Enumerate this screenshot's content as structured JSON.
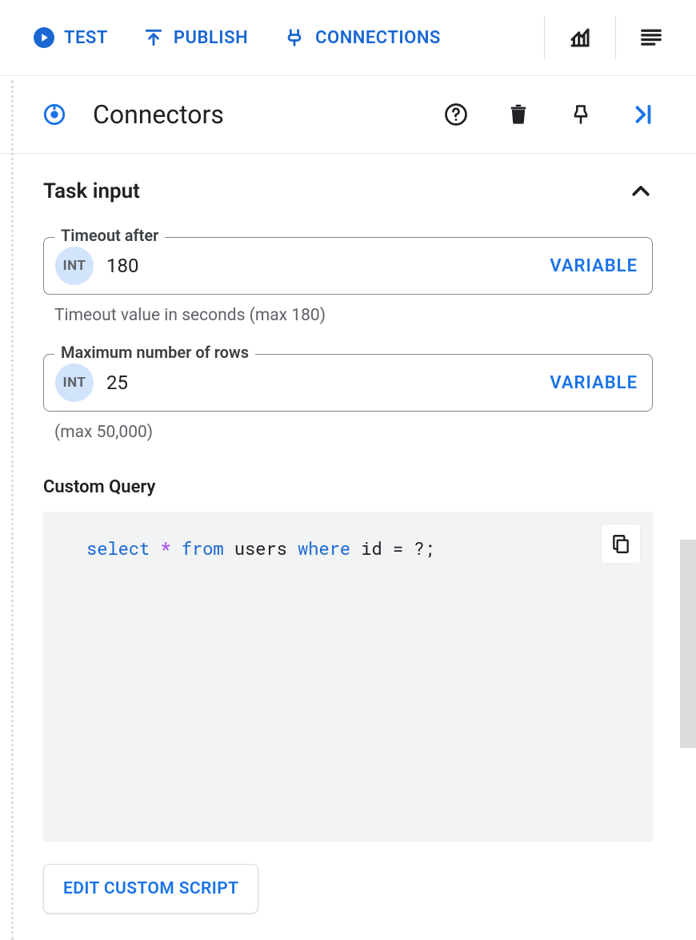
{
  "toolbar": {
    "test_label": "TEST",
    "publish_label": "PUBLISH",
    "connections_label": "CONNECTIONS"
  },
  "panel": {
    "title": "Connectors"
  },
  "section": {
    "task_input_title": "Task input"
  },
  "fields": {
    "timeout": {
      "label": "Timeout after",
      "type_badge": "INT",
      "value": "180",
      "variable_label": "VARIABLE",
      "helper": "Timeout value in seconds (max 180)"
    },
    "max_rows": {
      "label": "Maximum number of rows",
      "type_badge": "INT",
      "value": "25",
      "variable_label": "VARIABLE",
      "helper": "(max 50,000)"
    }
  },
  "query": {
    "label": "Custom Query",
    "tokens": {
      "select": "select",
      "star": "*",
      "from": "from",
      "table": "users",
      "where": "where",
      "col": "id",
      "tail": " = ?;"
    },
    "edit_button_label": "EDIT CUSTOM SCRIPT"
  }
}
